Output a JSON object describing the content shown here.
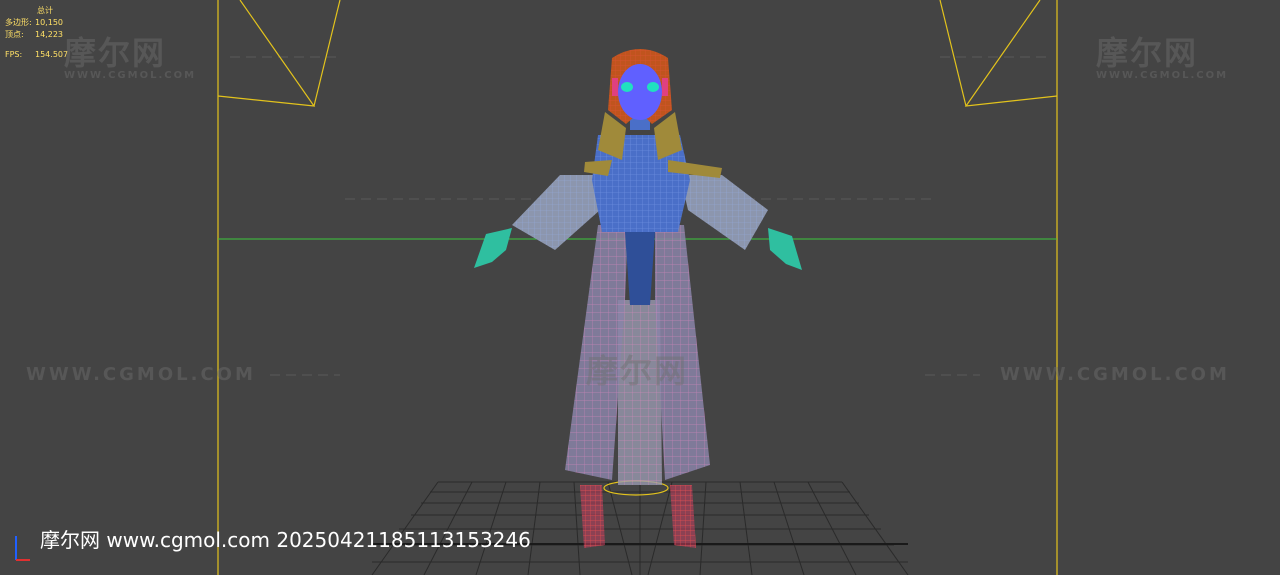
{
  "viewport": {
    "background": "#444444",
    "stats": {
      "header": "总计",
      "polys_label": "多边形:",
      "polys_value": "10,150",
      "verts_label": "顶点:",
      "verts_value": "14,223",
      "fps_label": "FPS:",
      "fps_value": "154.507"
    },
    "watermarks": {
      "brand": "摩尔网",
      "brand_url": "WWW.CGMOL.COM",
      "url_large": "WWW.CGMOL.COM"
    },
    "footer": "摩尔网 www.cgmol.com 20250421185113153246"
  },
  "colors": {
    "frame_yellow": "#e3c31c",
    "horizon_green": "#3cc83c",
    "grid_line": "#2a2a2a",
    "stats_text": "#ffe066",
    "hair": "#c0541e",
    "face": "#6060ff",
    "jacket": "#4a6fc8",
    "fur": "#a08a3a",
    "sleeve": "#8c96ae",
    "skirt": "#8a84a8",
    "skirt_wire": "#ff88cc",
    "hands": "#2fbfa0",
    "boots": "#e04060"
  }
}
